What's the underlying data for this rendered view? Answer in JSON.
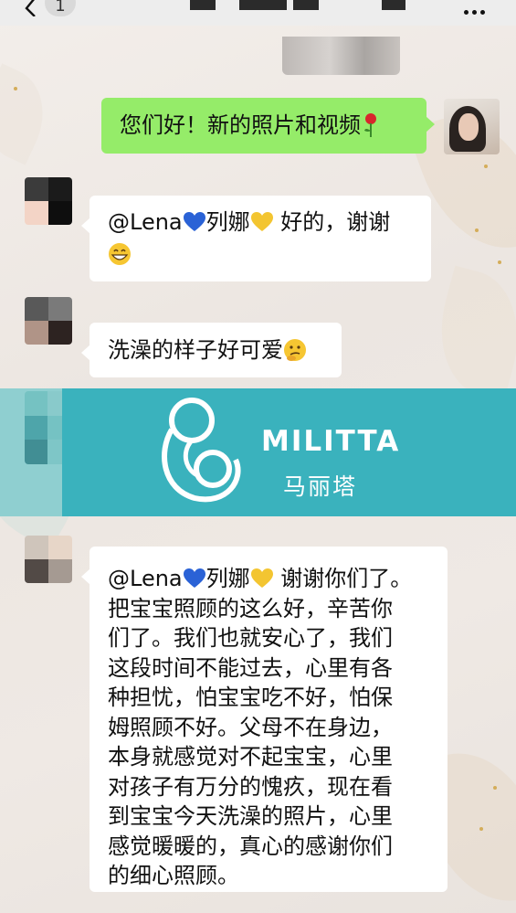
{
  "topbar": {
    "unread_count": "1"
  },
  "messages": [
    {
      "sender": "me",
      "text": "您们好！新的照片和视频",
      "emoji": "rose-icon"
    },
    {
      "sender": "other",
      "mention": "@Lena",
      "name": "列娜",
      "text_after": " 好的，谢谢",
      "emoji": "grinning-face-icon"
    },
    {
      "sender": "other",
      "text": "洗澡的样子好可爱",
      "emoji": "thinking-face-icon"
    },
    {
      "sender": "other",
      "mention": "@Lena",
      "name": "列娜",
      "lines": [
        " 谢谢你们了。",
        "把宝宝照顾的这么好，辛苦你",
        "们了。我们也就安心了，我们",
        "这段时间不能过去，心里有各",
        "种担忧，怕宝宝吃不好，怕保",
        "姆照顾不好。父母不在身边，",
        "本身就感觉对不起宝宝，心里",
        "对孩子有万分的愧疚，现在看",
        "到宝宝今天洗澡的照片，心里",
        "感觉暖暖的，真心的感谢你们",
        "的细心照顾。"
      ]
    }
  ],
  "banner": {
    "brand_name": "MILITTA",
    "brand_cn": "马丽塔",
    "color": "#3ab2bd"
  },
  "colors": {
    "my_bubble": "#95ec69",
    "other_bubble": "#ffffff"
  }
}
